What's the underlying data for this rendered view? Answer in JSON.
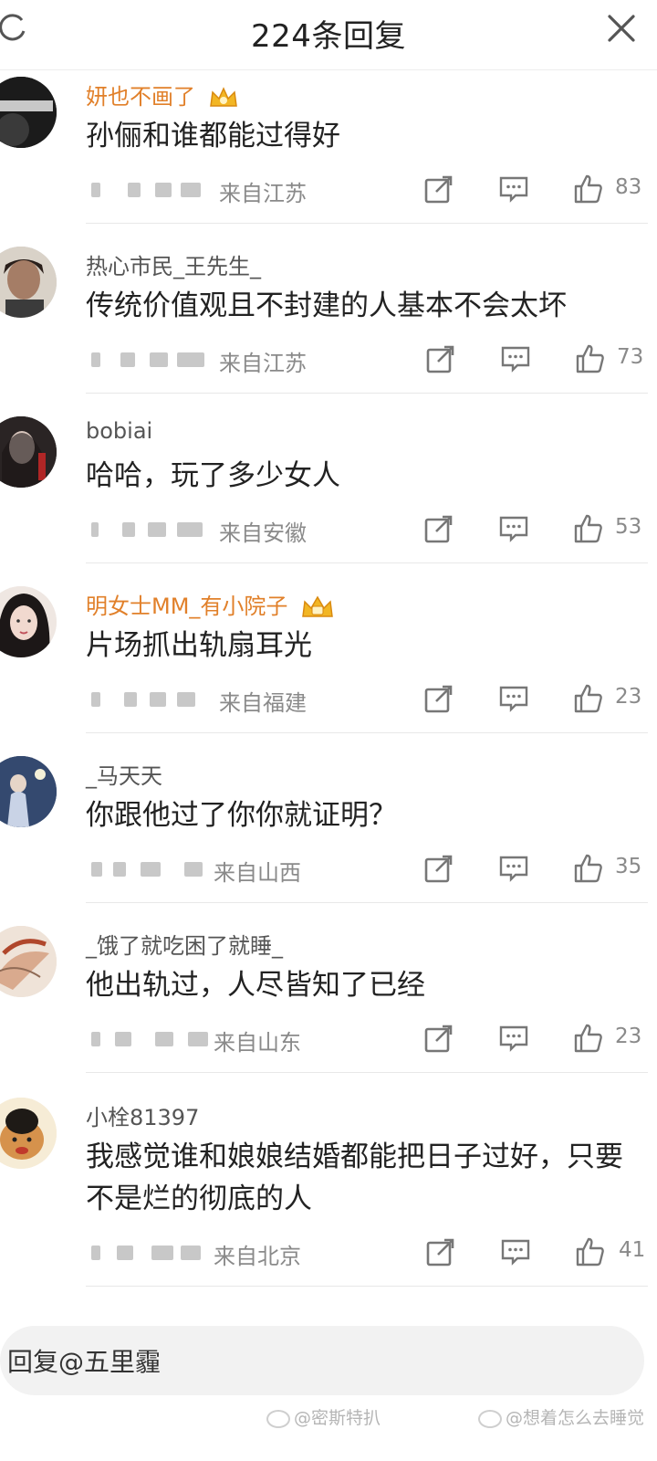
{
  "header": {
    "title": "224条回复"
  },
  "comments": [
    {
      "username": "妍也不画了",
      "vip": true,
      "text": "孙俪和谁都能过得好",
      "location": "来自江苏",
      "likes": "83"
    },
    {
      "username": "热心市民_王先生_",
      "vip": false,
      "text": "传统价值观且不封建的人基本不会太坏",
      "location": "来自江苏",
      "likes": "73"
    },
    {
      "username": "bobiai",
      "vip": false,
      "text": "哈哈，玩了多少女人",
      "location": "来自安徽",
      "likes": "53"
    },
    {
      "username": "明女士MM_有小院子",
      "vip": true,
      "text": "片场抓出轨扇耳光",
      "location": "来自福建",
      "likes": "23"
    },
    {
      "username": "_马天天",
      "vip": false,
      "text": "你跟他过了你你就证明？",
      "location": "来自山西",
      "likes": "35"
    },
    {
      "username": "_饿了就吃困了就睡_",
      "vip": false,
      "text": "他出轨过，人尽皆知了已经",
      "location": "来自山东",
      "likes": "23"
    },
    {
      "username": "小栓81397",
      "vip": false,
      "text": "我感觉谁和娘娘结婚都能把日子过好，只要不是烂的彻底的人",
      "location": "来自北京",
      "likes": "41"
    }
  ],
  "reply": {
    "placeholder": "回复@五里霾"
  },
  "watermarks": [
    "@密斯特扒",
    "@想着怎么去睡觉"
  ],
  "icons": [
    "refresh-icon",
    "close-icon",
    "share-icon",
    "comment-icon",
    "like-icon",
    "crown-icon"
  ],
  "colors": {
    "vip_name": "#e1802a",
    "gray_text": "#8a8a8a",
    "text": "#222222"
  }
}
